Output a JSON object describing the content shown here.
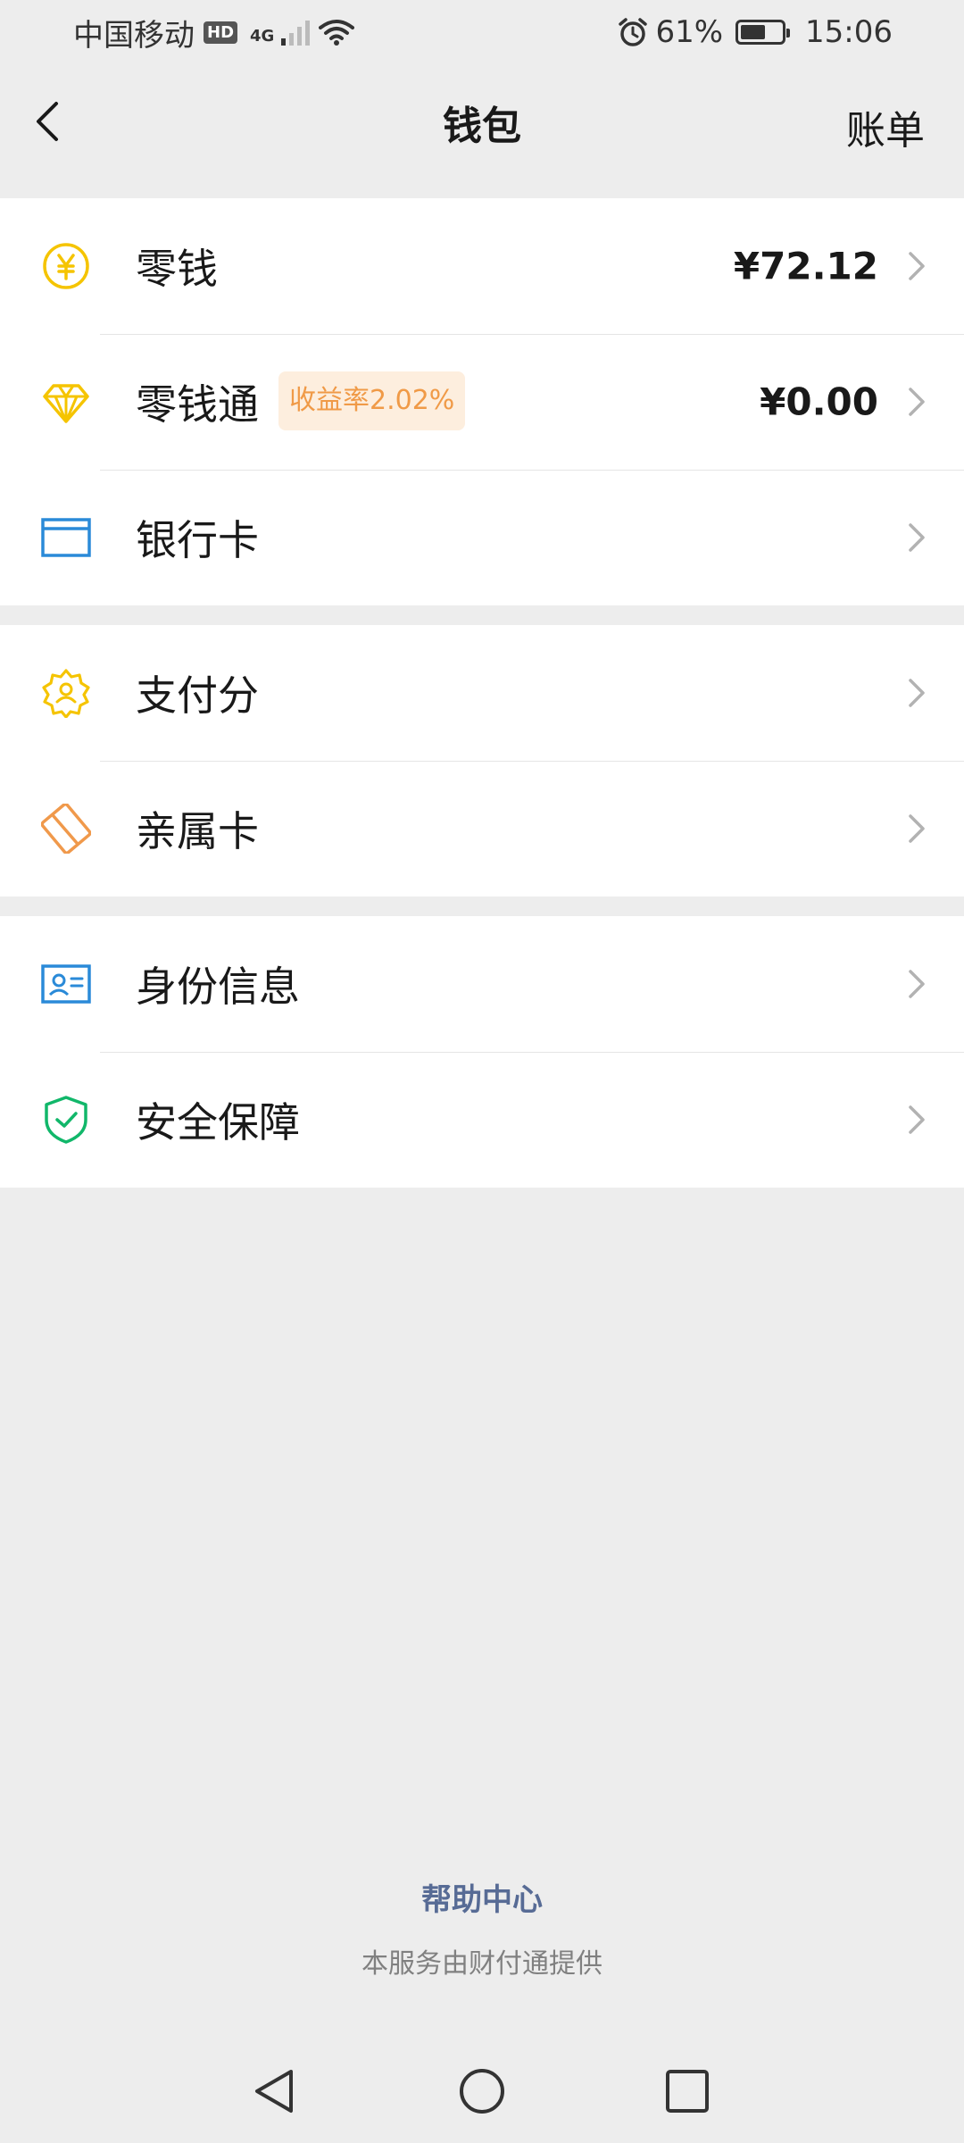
{
  "status_bar": {
    "carrier": "中国移动",
    "hd": "HD",
    "network": "4G",
    "battery": "61%",
    "battery_level": 0.61,
    "time": "15:06"
  },
  "header": {
    "title": "钱包",
    "action": "账单"
  },
  "groups": [
    {
      "items": [
        {
          "label": "零钱",
          "value": "¥72.12",
          "icon": "yuan-coin-icon",
          "color": "#f5c400"
        },
        {
          "label": "零钱通",
          "badge": "收益率2.02%",
          "value": "¥0.00",
          "icon": "diamond-icon",
          "color": "#f5c400"
        },
        {
          "label": "银行卡",
          "icon": "bank-card-icon",
          "color": "#2a8ad8"
        }
      ]
    },
    {
      "items": [
        {
          "label": "支付分",
          "icon": "pay-score-icon",
          "color": "#f5c400"
        },
        {
          "label": "亲属卡",
          "icon": "family-card-icon",
          "color": "#f0994b"
        }
      ]
    },
    {
      "items": [
        {
          "label": "身份信息",
          "icon": "id-card-icon",
          "color": "#2a8ad8"
        },
        {
          "label": "安全保障",
          "icon": "shield-icon",
          "color": "#11b76a"
        }
      ]
    }
  ],
  "footer": {
    "help": "帮助中心",
    "note": "本服务由财付通提供"
  }
}
